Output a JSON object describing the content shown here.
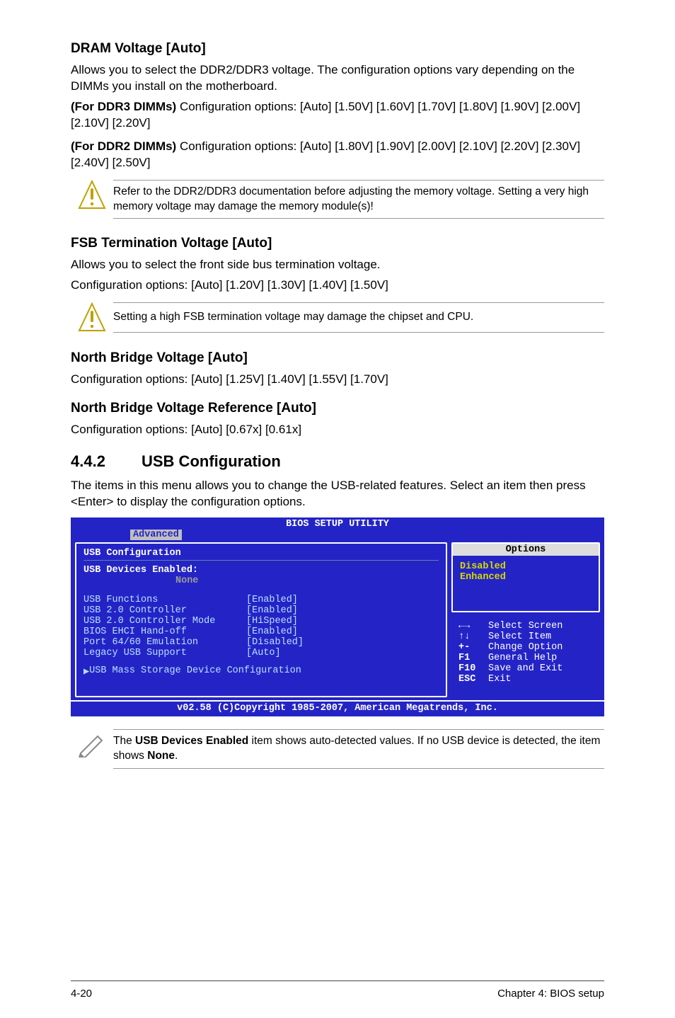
{
  "sections": {
    "dram": {
      "title": "DRAM Voltage [Auto]",
      "p1": "Allows you to select the DDR2/DDR3 voltage. The configuration options vary depending on the DIMMs you install on the motherboard.",
      "ddr3_label": "(For DDR3 DIMMs)",
      "ddr3_text": " Configuration options: [Auto] [1.50V] [1.60V] [1.70V] [1.80V] [1.90V] [2.00V] [2.10V] [2.20V]",
      "ddr2_label": "(For DDR2 DIMMs)",
      "ddr2_text": " Configuration options: [Auto] [1.80V] [1.90V] [2.00V] [2.10V] [2.20V] [2.30V] [2.40V] [2.50V]",
      "warn": "Refer to the DDR2/DDR3 documentation before adjusting the memory voltage. Setting a very high memory voltage may damage the memory module(s)!"
    },
    "fsb": {
      "title": "FSB Termination Voltage [Auto]",
      "p1": "Allows you to select the front side bus termination voltage.",
      "p2": "Configuration options: [Auto] [1.20V] [1.30V] [1.40V] [1.50V]",
      "warn": "Setting a high FSB termination voltage may damage the chipset and CPU."
    },
    "nbv": {
      "title": "North Bridge Voltage [Auto]",
      "p1": "Configuration options: [Auto] [1.25V] [1.40V] [1.55V] [1.70V]"
    },
    "nbvr": {
      "title": "North Bridge Voltage Reference [Auto]",
      "p1": "Configuration options: [Auto] [0.67x] [0.61x]"
    },
    "usb": {
      "num": "4.4.2",
      "title": "USB Configuration",
      "p1": "The items in this menu allows you to change the USB-related features. Select an item then press <Enter> to display the configuration options."
    },
    "usbnote": {
      "t1": "The ",
      "b1": "USB Devices Enabled",
      "t2": " item shows auto-detected values. If no USB device is detected, the item shows ",
      "b2": "None",
      "t3": "."
    }
  },
  "bios": {
    "title": "BIOS SETUP UTILITY",
    "tab": "Advanced",
    "left_title": "USB Configuration",
    "dev_label": "USB Devices Enabled:",
    "dev_value": "None",
    "rows": [
      {
        "lbl": "USB Functions",
        "val": "[Enabled]"
      },
      {
        "lbl": "USB 2.0 Controller",
        "val": "[Enabled]"
      },
      {
        "lbl": "USB 2.0 Controller Mode",
        "val": "[HiSpeed]"
      },
      {
        "lbl": "BIOS EHCI Hand-off",
        "val": "[Enabled]"
      },
      {
        "lbl": "Port 64/60 Emulation",
        "val": "[Disabled]"
      },
      {
        "lbl": "Legacy USB Support",
        "val": "[Auto]"
      }
    ],
    "submenu": "USB Mass Storage Device Configuration",
    "options_title": "Options",
    "options": [
      "Disabled",
      "Enhanced"
    ],
    "help": [
      {
        "k": "←→",
        "t": "Select Screen"
      },
      {
        "k": "↑↓",
        "t": "Select Item"
      },
      {
        "k": "+-",
        "t": "Change Option"
      },
      {
        "k": "F1",
        "t": "General Help"
      },
      {
        "k": "F10",
        "t": "Save and Exit"
      },
      {
        "k": "ESC",
        "t": "Exit"
      }
    ],
    "footer": "v02.58 (C)Copyright 1985-2007, American Megatrends, Inc."
  },
  "page": {
    "left": "4-20",
    "right": "Chapter 4: BIOS setup"
  }
}
